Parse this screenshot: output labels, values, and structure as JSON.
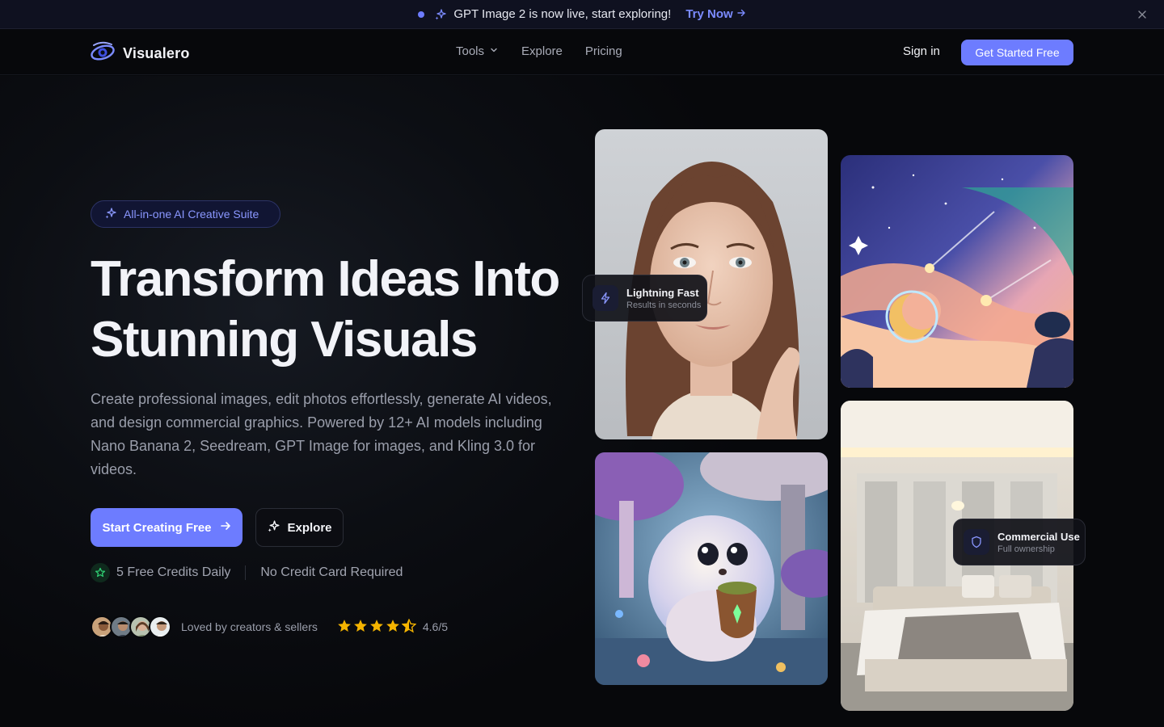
{
  "announcement": {
    "text": "GPT Image 2 is now live, start exploring!",
    "link_label": "Try Now"
  },
  "nav": {
    "brand": "Visualero",
    "links": [
      {
        "label": "Tools"
      },
      {
        "label": "Explore"
      },
      {
        "label": "Pricing"
      }
    ],
    "signin": "Sign in",
    "cta": "Get Started Free"
  },
  "hero": {
    "badge": "All-in-one AI Creative Suite",
    "headline_line1": "Transform Ideas Into",
    "headline_line2": "Stunning Visuals",
    "subtitle": "Create professional images, edit photos effortlessly, generate AI videos, and design commercial graphics. Powered by 12+ AI models including Nano Banana 2, Seedream, GPT Image for images, and Kling 3.0 for videos.",
    "primary_button": "Start Creating Free",
    "secondary_button": "Explore",
    "perk1": "5 Free Credits Daily",
    "perk2": "No Credit Card Required",
    "social_text": "Loved by creators & sellers",
    "rating": "4.6/5"
  },
  "gallery": {
    "tag1_title": "Lightning Fast",
    "tag1_sub": "Results in seconds",
    "tag2_title": "Commercial Use",
    "tag2_sub": "Full ownership"
  },
  "colors": {
    "accent": "#6d7cff",
    "star": "#f5b400",
    "background": "#07080b"
  }
}
